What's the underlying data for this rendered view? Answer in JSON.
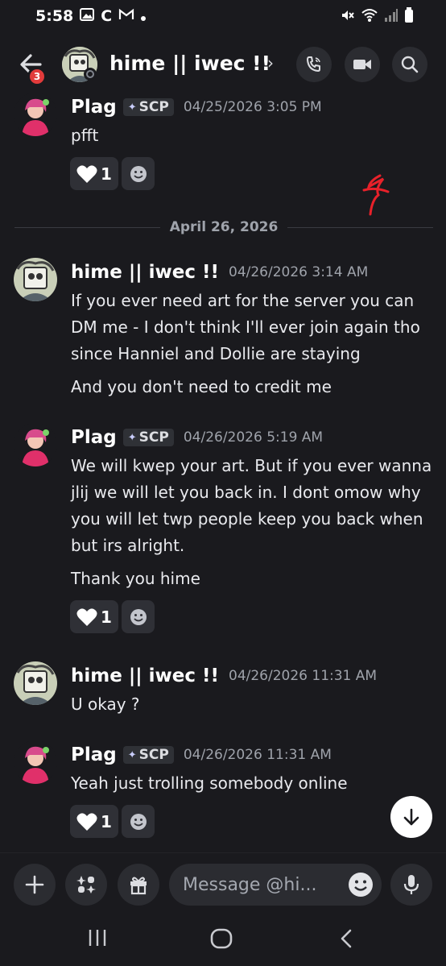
{
  "status_bar": {
    "time": "5:58",
    "icons": [
      "gallery-icon",
      "c-app-icon",
      "gmail-icon",
      "dot-icon",
      "mute-icon",
      "wifi-icon",
      "signal-icon",
      "battery-icon"
    ],
    "letter_c": "C"
  },
  "header": {
    "back_badge": "3",
    "title": "hime || iwec !!",
    "chevron": "›",
    "buttons": [
      "call-icon",
      "video-icon",
      "search-icon"
    ]
  },
  "messages": [
    {
      "author": "Plag",
      "tag": "SCP",
      "time": "04/25/2026 3:05 PM",
      "lines": [
        "pfft"
      ],
      "reaction_count": "1"
    },
    {
      "author": "hime || iwec !!",
      "time": "04/26/2026 3:14 AM",
      "lines": [
        "If you ever need art for the server you can DM me - I don't think I'll ever join again tho since Hanniel and Dollie are staying",
        "And you don't need to credit me"
      ]
    },
    {
      "author": "Plag",
      "tag": "SCP",
      "time": "04/26/2026 5:19 AM",
      "lines": [
        "We will kwep your art. But if you ever wanna jlij we will let you back in. I dont omow why you will let twp people keep you back when  but irs alright.",
        "Thank you hime"
      ],
      "reaction_count": "1"
    },
    {
      "author": "hime || iwec !!",
      "time": "04/26/2026 11:31 AM",
      "lines": [
        "U okay ?"
      ]
    },
    {
      "author": "Plag",
      "tag": "SCP",
      "time": "04/26/2026 11:31 AM",
      "lines": [
        "Yeah just trolling somebody online"
      ],
      "reaction_count": "1"
    }
  ],
  "date_divider": "April 26, 2026",
  "composer": {
    "placeholder": "Message @hi..."
  },
  "colors": {
    "background": "#1a1a1e",
    "surface": "#2b2c31",
    "badge_red": "#e23b3b",
    "scribble_red": "#e8212a"
  }
}
